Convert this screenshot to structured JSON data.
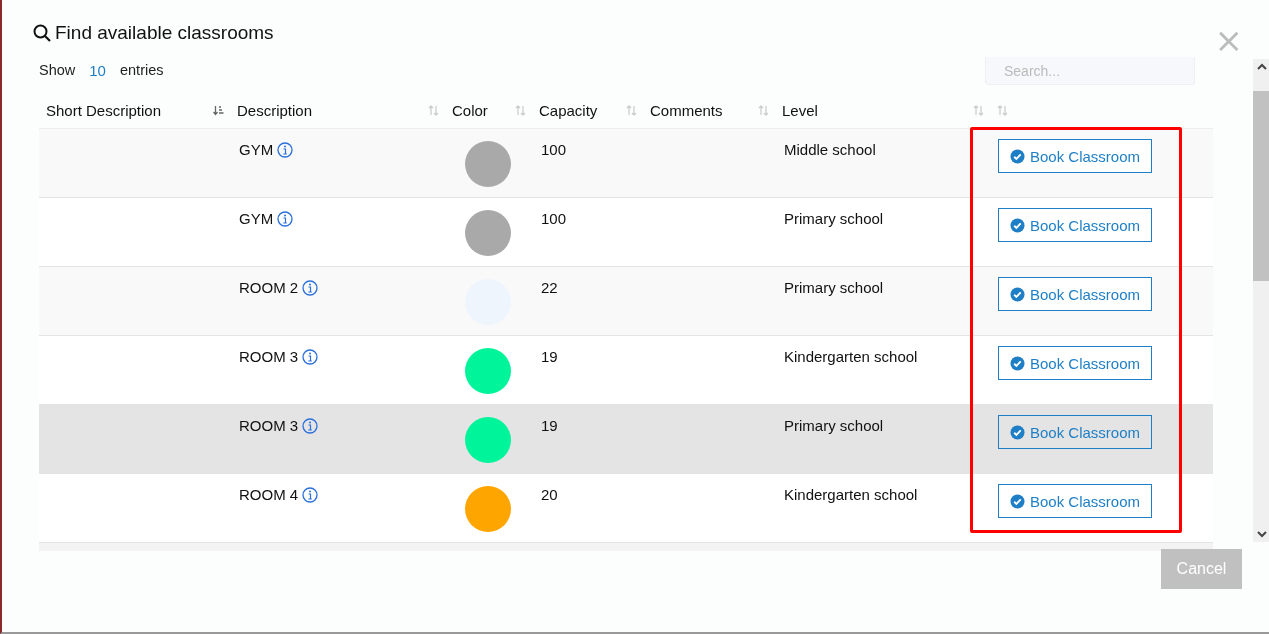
{
  "dialog": {
    "title": "Find available classrooms",
    "close": "×"
  },
  "length": {
    "label_before": "Show",
    "value": "10",
    "label_after": "entries"
  },
  "search": {
    "placeholder": "Search..."
  },
  "columns": [
    {
      "label": "Short Description",
      "sorted": true
    },
    {
      "label": "Description",
      "sorted": false
    },
    {
      "label": "Color",
      "sorted": false
    },
    {
      "label": "Capacity",
      "sorted": false
    },
    {
      "label": "Comments",
      "sorted": false
    },
    {
      "label": "Level",
      "sorted": false
    },
    {
      "sorted": false
    }
  ],
  "rows": [
    {
      "description": "GYM",
      "color": "#a9a9a9",
      "capacity": "100",
      "level": "Middle school",
      "action": "Book Classroom",
      "highlighted": false
    },
    {
      "description": "GYM",
      "color": "#a9a9a9",
      "capacity": "100",
      "level": "Primary school",
      "action": "Book Classroom",
      "highlighted": false
    },
    {
      "description": "ROOM 2",
      "color": "#eef5fd",
      "capacity": "22",
      "level": "Primary school",
      "action": "Book Classroom",
      "highlighted": false
    },
    {
      "description": "ROOM 3",
      "color": "#00f59b",
      "capacity": "19",
      "level": "Kindergarten school",
      "action": "Book Classroom",
      "highlighted": false
    },
    {
      "description": "ROOM 3",
      "color": "#00f59b",
      "capacity": "19",
      "level": "Primary school",
      "action": "Book Classroom",
      "highlighted": true
    },
    {
      "description": "ROOM 4",
      "color": "#ffa500",
      "capacity": "20",
      "level": "Kindergarten school",
      "action": "Book Classroom",
      "highlighted": false
    }
  ],
  "footer": {
    "cancel": "Cancel"
  }
}
